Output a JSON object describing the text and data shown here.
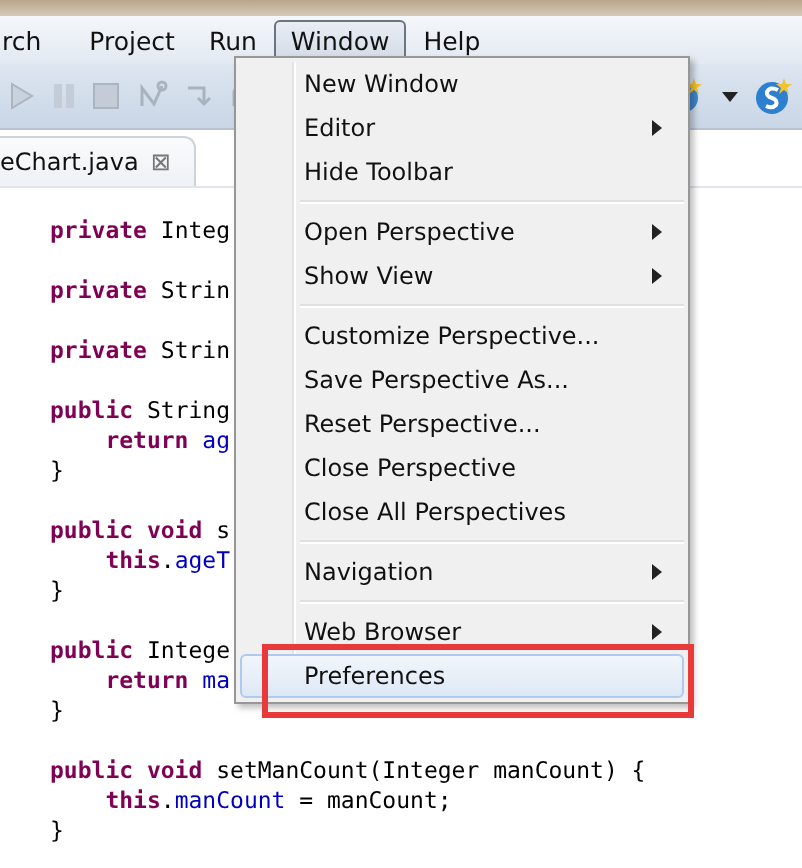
{
  "menu_bar": [
    {
      "label": "rch",
      "selected": false
    },
    {
      "label": "Project",
      "selected": false
    },
    {
      "label": "Run",
      "selected": false
    },
    {
      "label": "Window",
      "selected": true
    },
    {
      "label": "Help",
      "selected": false
    }
  ],
  "editor_tab": {
    "label": "eChart.java",
    "close": "⊠"
  },
  "code_blocks": [
    [
      [
        {
          "kind": "keyword",
          "text": "private"
        },
        {
          "kind": "plain",
          "text": " Integ"
        }
      ]
    ],
    [
      [
        {
          "kind": "keyword",
          "text": "private"
        },
        {
          "kind": "plain",
          "text": " Strin"
        }
      ]
    ],
    [
      [
        {
          "kind": "keyword",
          "text": "private"
        },
        {
          "kind": "plain",
          "text": " Strin"
        }
      ]
    ],
    [
      [
        {
          "kind": "keyword",
          "text": "public"
        },
        {
          "kind": "plain",
          "text": " String"
        }
      ],
      [
        {
          "kind": "keyword",
          "text": "    return"
        },
        {
          "kind": "field",
          "text": " ag"
        }
      ],
      [
        {
          "kind": "plain",
          "text": "}"
        }
      ]
    ],
    [
      [
        {
          "kind": "keyword",
          "text": "public void"
        },
        {
          "kind": "plain",
          "text": " s"
        }
      ],
      [
        {
          "kind": "keyword",
          "text": "    this"
        },
        {
          "kind": "plain",
          "text": "."
        },
        {
          "kind": "field",
          "text": "ageT"
        }
      ],
      [
        {
          "kind": "plain",
          "text": "}"
        }
      ]
    ],
    [
      [
        {
          "kind": "keyword",
          "text": "public"
        },
        {
          "kind": "plain",
          "text": " Intege"
        }
      ],
      [
        {
          "kind": "keyword",
          "text": "    return"
        },
        {
          "kind": "field",
          "text": " ma"
        }
      ],
      [
        {
          "kind": "plain",
          "text": "}"
        }
      ]
    ],
    [
      [
        {
          "kind": "keyword",
          "text": "public void"
        },
        {
          "kind": "plain",
          "text": " setManCount(Integer manCount) {"
        }
      ],
      [
        {
          "kind": "keyword",
          "text": "    this"
        },
        {
          "kind": "plain",
          "text": "."
        },
        {
          "kind": "field",
          "text": "manCount"
        },
        {
          "kind": "plain",
          "text": " = manCount;"
        }
      ],
      [
        {
          "kind": "plain",
          "text": "}"
        }
      ]
    ]
  ],
  "window_menu": [
    {
      "kind": "item",
      "label": "New Window",
      "submenu": false,
      "highlighted": false,
      "boxed": false
    },
    {
      "kind": "item",
      "label": "Editor",
      "submenu": true,
      "highlighted": false,
      "boxed": false
    },
    {
      "kind": "item",
      "label": "Hide Toolbar",
      "submenu": false,
      "highlighted": false,
      "boxed": false
    },
    {
      "kind": "separator"
    },
    {
      "kind": "item",
      "label": "Open Perspective",
      "submenu": true,
      "highlighted": false,
      "boxed": false
    },
    {
      "kind": "item",
      "label": "Show View",
      "submenu": true,
      "highlighted": false,
      "boxed": false
    },
    {
      "kind": "separator"
    },
    {
      "kind": "item",
      "label": "Customize Perspective...",
      "submenu": false,
      "highlighted": false,
      "boxed": false
    },
    {
      "kind": "item",
      "label": "Save Perspective As...",
      "submenu": false,
      "highlighted": false,
      "boxed": false
    },
    {
      "kind": "item",
      "label": "Reset Perspective...",
      "submenu": false,
      "highlighted": false,
      "boxed": false
    },
    {
      "kind": "item",
      "label": "Close Perspective",
      "submenu": false,
      "highlighted": false,
      "boxed": false
    },
    {
      "kind": "item",
      "label": "Close All Perspectives",
      "submenu": false,
      "highlighted": false,
      "boxed": false
    },
    {
      "kind": "separator"
    },
    {
      "kind": "item",
      "label": "Navigation",
      "submenu": true,
      "highlighted": false,
      "boxed": false
    },
    {
      "kind": "separator"
    },
    {
      "kind": "item",
      "label": "Web Browser",
      "submenu": true,
      "highlighted": false,
      "boxed": false
    },
    {
      "kind": "item",
      "label": "Preferences",
      "submenu": false,
      "highlighted": true,
      "boxed": true
    }
  ]
}
